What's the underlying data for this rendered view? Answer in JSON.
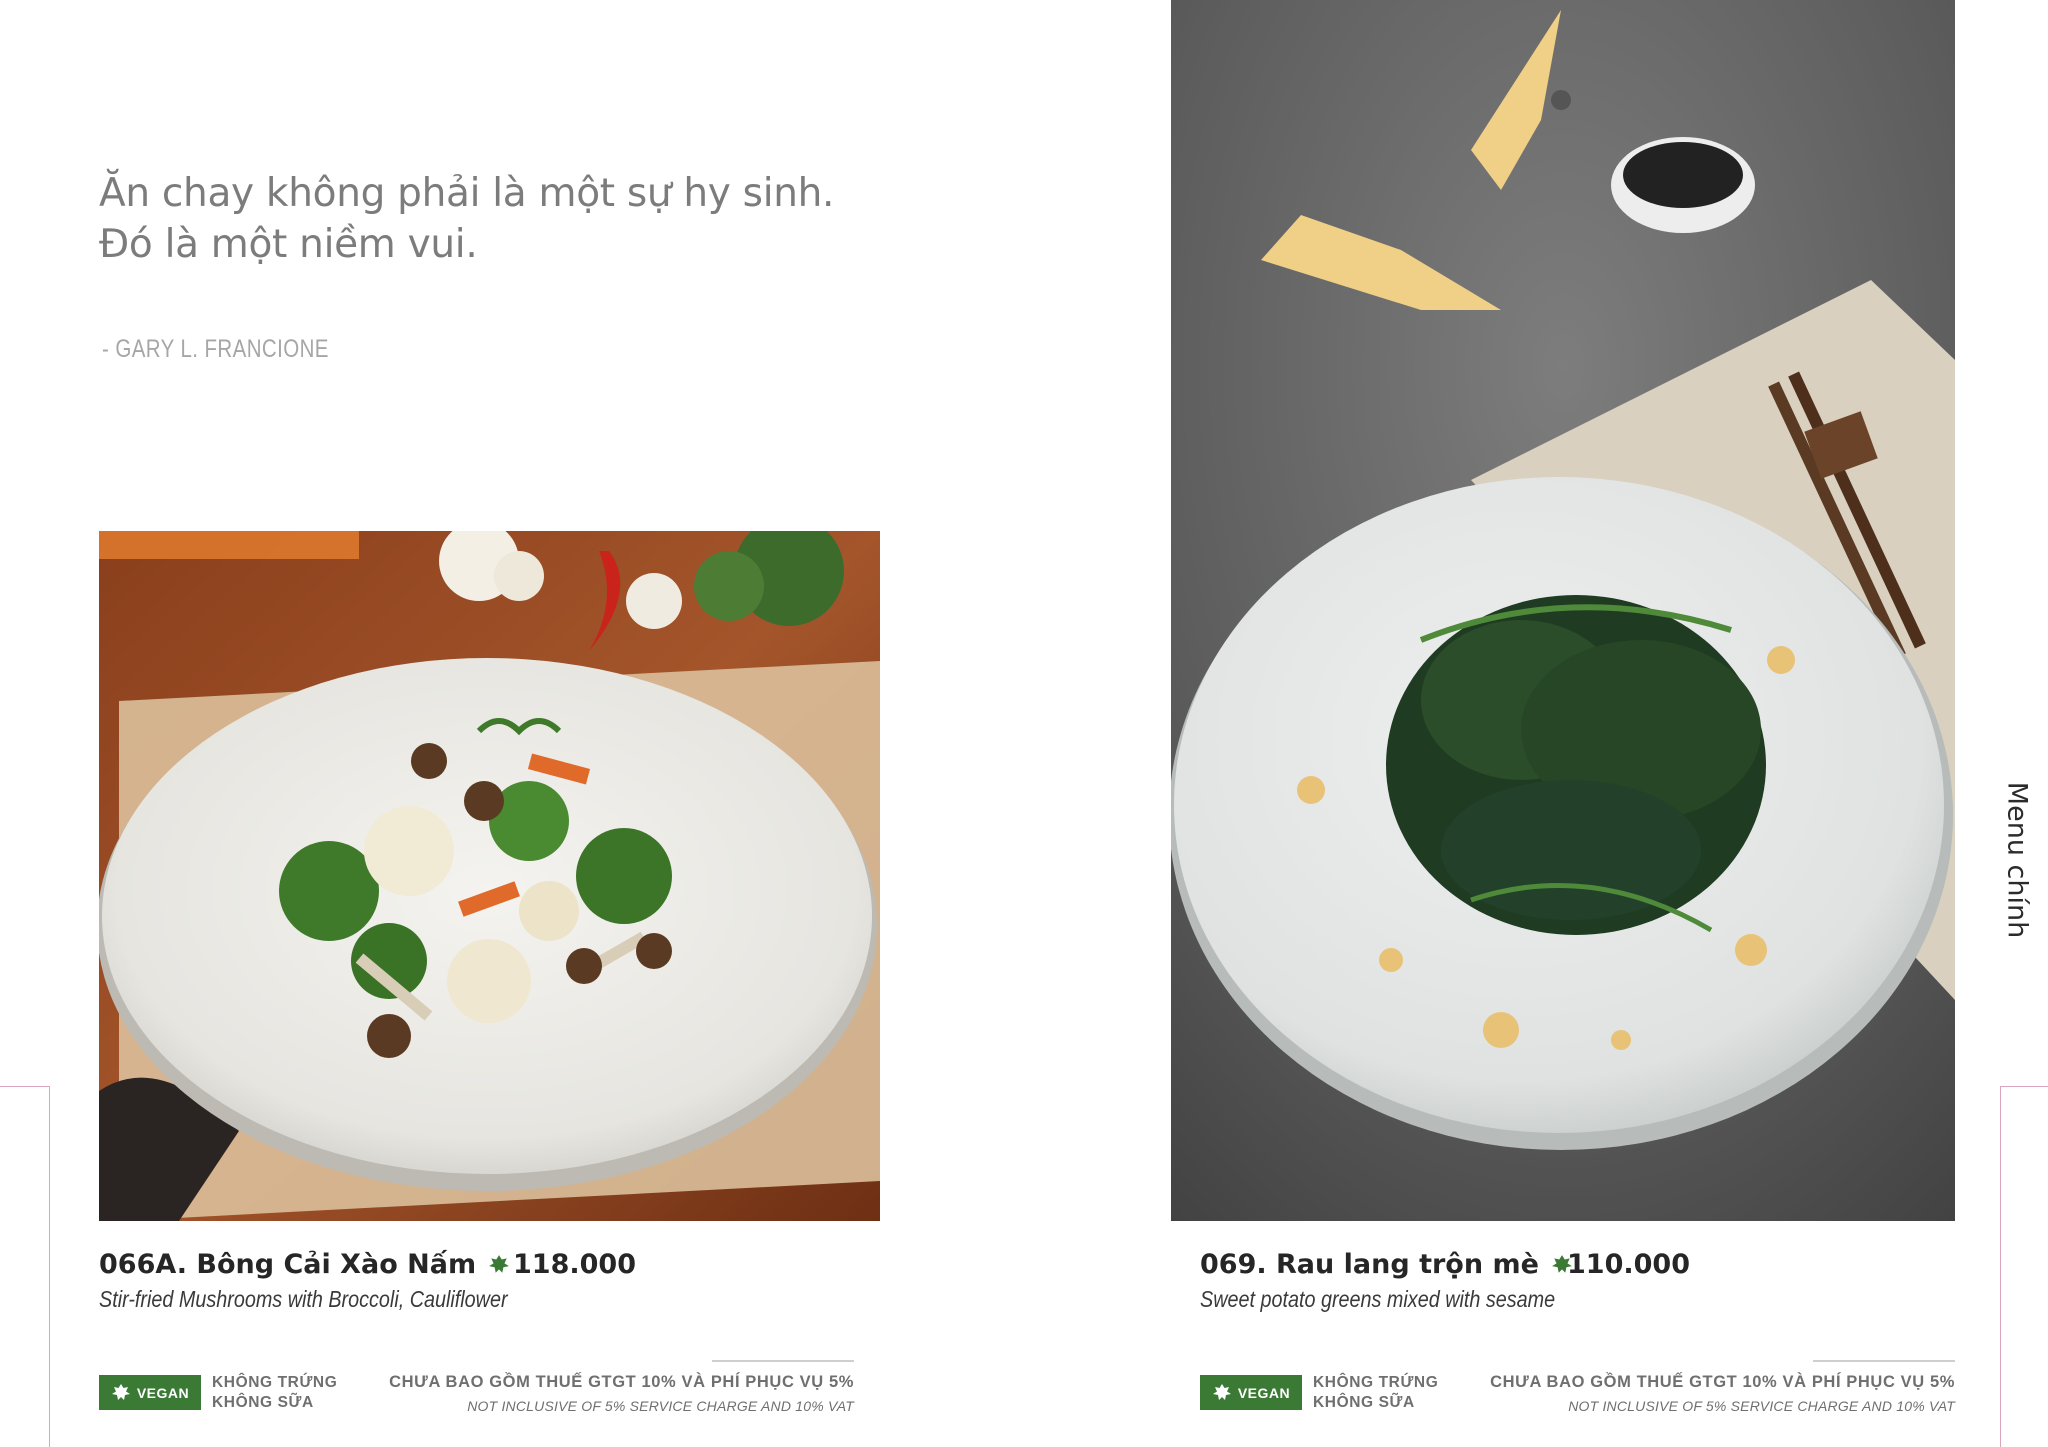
{
  "quote": {
    "line1": "Ăn chay không phải là một sự hy sinh.",
    "line2": "Đó là một niềm vui.",
    "author": "- GARY L. FRANCIONE"
  },
  "section_label": "Menu chính",
  "dishes": [
    {
      "title": "066A. Bông Cải Xào Nấm",
      "price": "118.000",
      "subtitle": "Stir-fried Mushrooms with Broccoli, Cauliflower",
      "vegan_label": "VEGAN",
      "notes_line1": "KHÔNG TRỨNG",
      "notes_line2": "KHÔNG SỮA",
      "tax_vi": "CHƯA BAO GỒM THUẾ GTGT 10% VÀ PHÍ PHỤC VỤ 5%",
      "tax_en": "NOT INCLUSIVE OF 5% SERVICE CHARGE AND 10% VAT"
    },
    {
      "title": "069. Rau lang trộn mè",
      "price": "110.000",
      "subtitle": "Sweet potato greens mixed with sesame",
      "vegan_label": "VEGAN",
      "notes_line1": "KHÔNG TRỨNG",
      "notes_line2": "KHÔNG SỮA",
      "tax_vi": "CHƯA BAO GỒM THUẾ GTGT 10% VÀ PHÍ PHỤC VỤ 5%",
      "tax_en": "NOT INCLUSIVE OF 5% SERVICE CHARGE AND 10% VAT"
    }
  ],
  "colors": {
    "vegan_green": "#3b7a35",
    "frame_pink": "#d9a6bd",
    "quote_gray": "#7c7c7c"
  },
  "icons": [
    "leaf-icon",
    "vegan-leaf-icon"
  ]
}
